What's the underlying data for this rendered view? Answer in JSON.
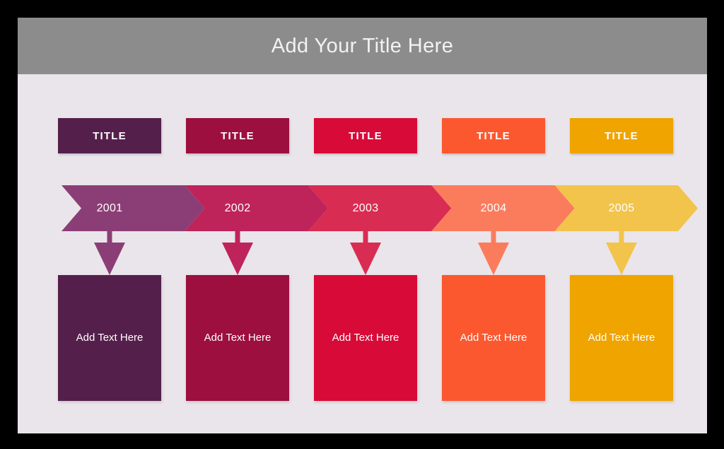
{
  "header": {
    "title": "Add Your Title Here",
    "bar_color": "#8C8C8C",
    "title_color": "#F2F2F2"
  },
  "slide": {
    "background": "#EAE5EA",
    "frame_color": "#000000"
  },
  "columns": [
    {
      "title_label": "TITLE",
      "year": "2001",
      "body_text": "Add Text Here",
      "box_color": "#551F4B",
      "band_color": "#8B3E76",
      "arrow_color": "#8B3E76"
    },
    {
      "title_label": "TITLE",
      "year": "2002",
      "body_text": "Add Text Here",
      "box_color": "#9C0F3F",
      "band_color": "#BE2459",
      "arrow_color": "#BE2459"
    },
    {
      "title_label": "TITLE",
      "year": "2003",
      "body_text": "Add Text Here",
      "box_color": "#D80A38",
      "band_color": "#D92C52",
      "arrow_color": "#D92C52"
    },
    {
      "title_label": "TITLE",
      "year": "2004",
      "body_text": "Add Text Here",
      "box_color": "#FB5830",
      "band_color": "#FB7C5D",
      "arrow_color": "#FB7C5D"
    },
    {
      "title_label": "TITLE",
      "year": "2005",
      "body_text": "Add Text Here",
      "box_color": "#EFA400",
      "band_color": "#F2C44C",
      "arrow_color": "#F2C44C"
    }
  ]
}
